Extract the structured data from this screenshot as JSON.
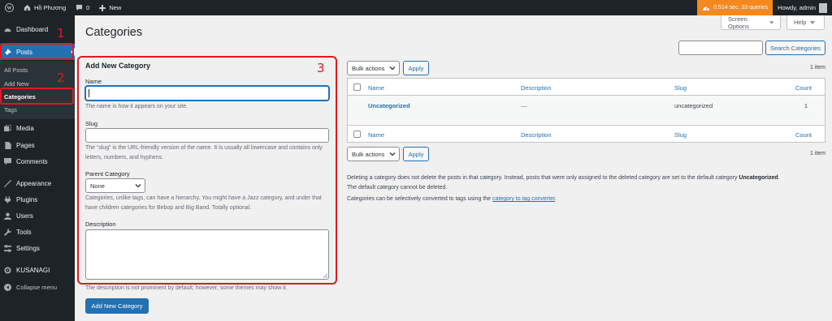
{
  "adminbar": {
    "site_name": "Hồ Phương",
    "comments_count": "0",
    "new_label": "New",
    "perf_text": "0.514 sec. 33 queries",
    "howdy": "Howdy, admin"
  },
  "sidebar": {
    "dashboard": "Dashboard",
    "posts": "Posts",
    "sub_all_posts": "All Posts",
    "sub_add_new": "Add New",
    "sub_categories": "Categories",
    "sub_tags": "Tags",
    "media": "Media",
    "pages": "Pages",
    "comments": "Comments",
    "appearance": "Appearance",
    "plugins": "Plugins",
    "users": "Users",
    "tools": "Tools",
    "settings": "Settings",
    "kusanagi": "KUSANAGI",
    "collapse": "Collapse menu"
  },
  "annotations": {
    "n1": "1",
    "n2": "2",
    "n3": "3"
  },
  "header": {
    "title": "Categories",
    "screen_options": "Screen Options",
    "help": "Help",
    "search_button": "Search Categories"
  },
  "form": {
    "title": "Add New Category",
    "name_label": "Name",
    "name_help": "The name is how it appears on your site.",
    "slug_label": "Slug",
    "slug_help": "The “slug” is the URL-friendly version of the name. It is usually all lowercase and contains only letters, numbers, and hyphens.",
    "parent_label": "Parent Category",
    "parent_value": "None",
    "parent_help": "Categories, unlike tags, can have a hierarchy. You might have a Jazz category, and under that have children categories for Bebop and Big Band. Totally optional.",
    "description_label": "Description",
    "description_help": "The description is not prominent by default; however, some themes may show it.",
    "submit": "Add New Category"
  },
  "table": {
    "bulk_actions": "Bulk actions",
    "apply": "Apply",
    "items_count": "1 item",
    "columns": {
      "name": "Name",
      "description": "Description",
      "slug": "Slug",
      "count": "Count"
    },
    "rows": [
      {
        "name": "Uncategorized",
        "description": "—",
        "slug": "uncategorized",
        "count": "1"
      }
    ]
  },
  "notes": {
    "line1_prefix": "Deleting a category does not delete the posts in that category. Instead, posts that were only assigned to the deleted category are set to the default category",
    "line1_bold": "Uncategorized",
    "line2": "The default category cannot be deleted.",
    "line3_prefix": "Categories can be selectively converted to tags using the",
    "line3_link": "category to tag converter",
    "line3_suffix": "."
  },
  "colors": {
    "accent": "#2271b1",
    "admin_bar": "#1d2327",
    "annotation": "#e0191f",
    "perf_badge": "#f5891f"
  }
}
